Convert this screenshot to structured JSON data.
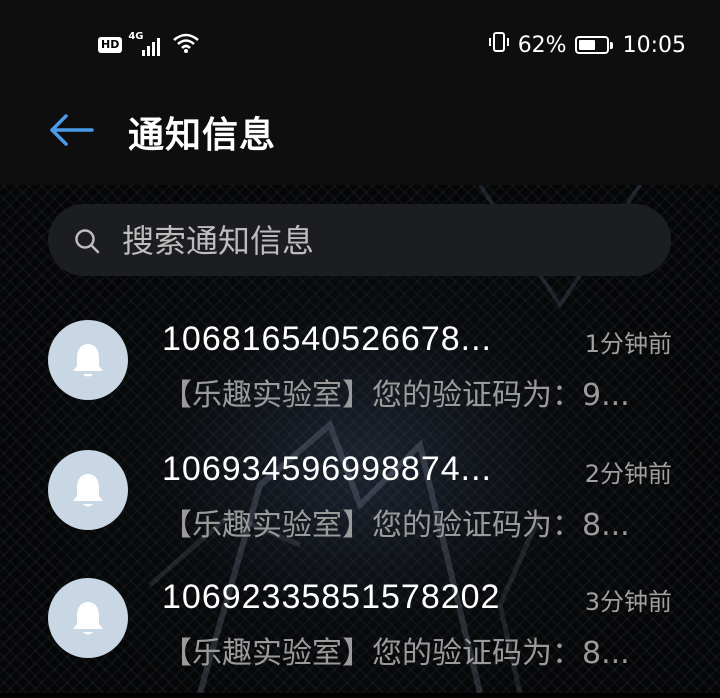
{
  "status_bar": {
    "network": "4G",
    "hd_label": "HD",
    "battery_percent": "62%",
    "battery_level": 0.62,
    "time": "10:05"
  },
  "header": {
    "title": "通知信息"
  },
  "search": {
    "placeholder": "搜索通知信息"
  },
  "messages": [
    {
      "sender": "106816540526678...",
      "time": "1分钟前",
      "preview": "【乐趣实验室】您的验证码为：9..."
    },
    {
      "sender": "106934596998874...",
      "time": "2分钟前",
      "preview": "【乐趣实验室】您的验证码为：8..."
    },
    {
      "sender": "10692335851578202",
      "time": "3分钟前",
      "preview": "【乐趣实验室】您的验证码为：8..."
    }
  ],
  "colors": {
    "accent": "#4a9be8",
    "avatar_bg": "#c9d6e3",
    "background": "#000000",
    "bar_bg": "#0e0e0e"
  }
}
